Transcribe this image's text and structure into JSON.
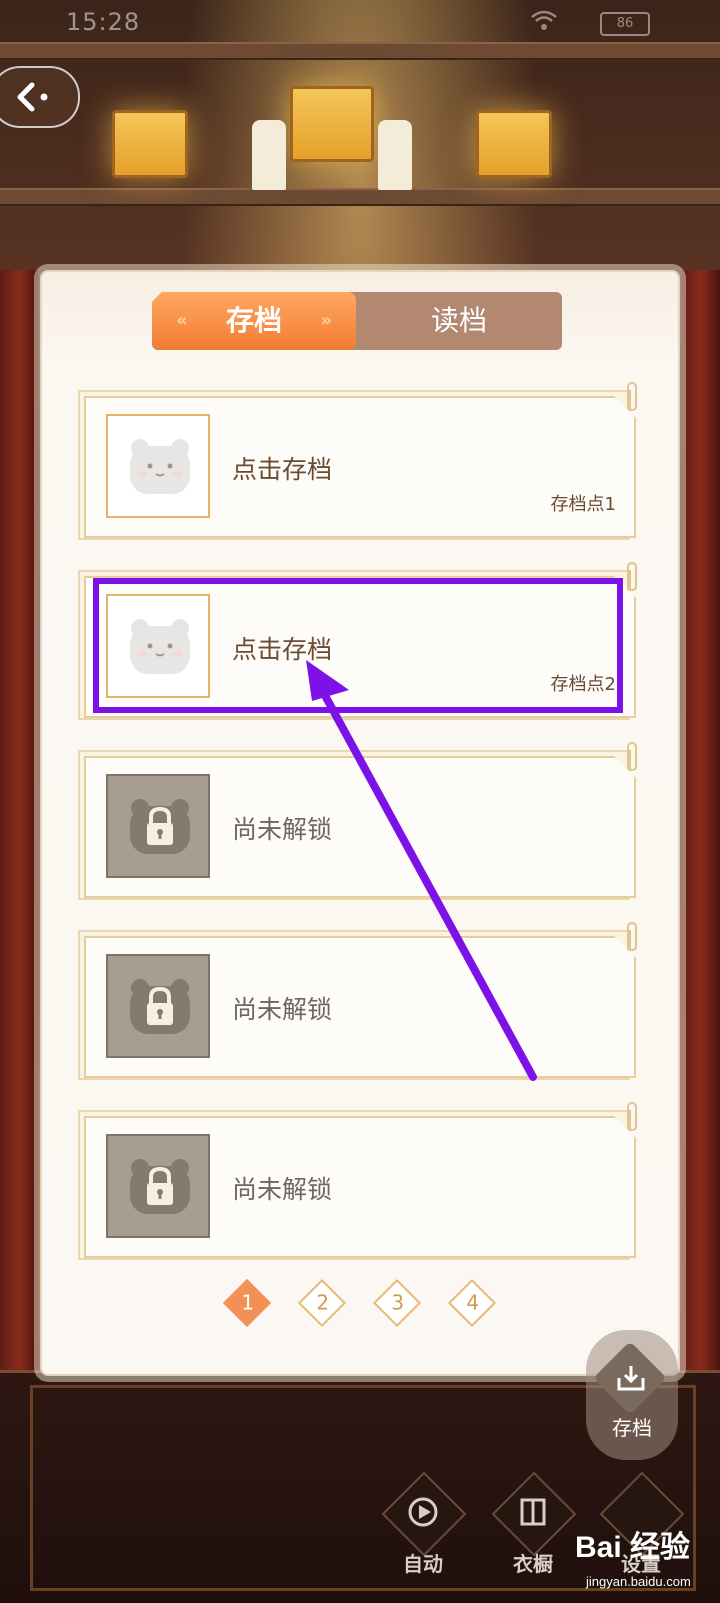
{
  "status_bar": {
    "time": "15:28",
    "battery": "86"
  },
  "tabs": {
    "save": "存档",
    "load": "读档"
  },
  "slots": [
    {
      "label": "点击存档",
      "name": "存档点1",
      "state": "empty"
    },
    {
      "label": "点击存档",
      "name": "存档点2",
      "state": "empty"
    },
    {
      "label": "尚未解锁",
      "name": "",
      "state": "locked"
    },
    {
      "label": "尚未解锁",
      "name": "",
      "state": "locked"
    },
    {
      "label": "尚未解锁",
      "name": "",
      "state": "locked"
    }
  ],
  "pagination": {
    "pages": [
      "1",
      "2",
      "3",
      "4"
    ],
    "current": "1"
  },
  "side_button": {
    "label": "存档"
  },
  "toolbar": {
    "auto": "自动",
    "wardrobe": "衣橱",
    "settings": "设置"
  },
  "watermark": {
    "logo": "Bai 经验",
    "url": "jingyan.baidu.com"
  },
  "colors": {
    "annotation": "#7d12e8",
    "tab_active": "#f37b34",
    "tab_inactive": "#b28870"
  },
  "icons": [
    "back-icon",
    "bear-placeholder-icon",
    "padlock-icon",
    "paperclip-icon",
    "save-download-icon",
    "play-icon",
    "wardrobe-icon"
  ]
}
